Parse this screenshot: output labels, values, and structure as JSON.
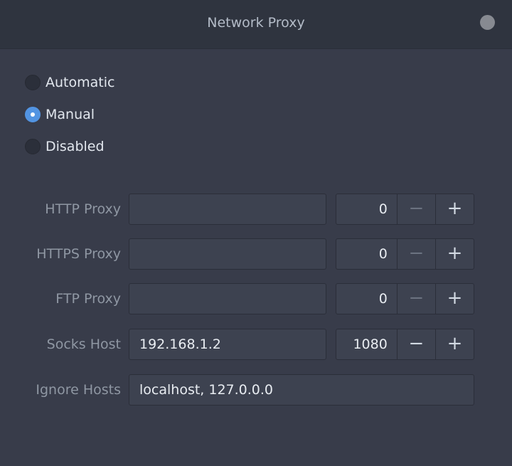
{
  "window": {
    "title": "Network Proxy"
  },
  "mode": {
    "options": [
      {
        "label": "Automatic",
        "checked": false
      },
      {
        "label": "Manual",
        "checked": true
      },
      {
        "label": "Disabled",
        "checked": false
      }
    ]
  },
  "proxies": {
    "http": {
      "label": "HTTP Proxy",
      "host": "",
      "port": "0"
    },
    "https": {
      "label": "HTTPS Proxy",
      "host": "",
      "port": "0"
    },
    "ftp": {
      "label": "FTP Proxy",
      "host": "",
      "port": "0"
    },
    "socks": {
      "label": "Socks Host",
      "host": "192.168.1.2",
      "port": "1080"
    }
  },
  "ignore_hosts": {
    "label": "Ignore Hosts",
    "value": "localhost, 127.0.0.0"
  },
  "spin_buttons": {
    "minus": "−",
    "plus": "+"
  },
  "colors": {
    "accent": "#5294e2",
    "background": "#383c4a",
    "titlebar": "#2f343f",
    "entry": "#3d4250"
  },
  "icons": {
    "close": "close-icon"
  }
}
